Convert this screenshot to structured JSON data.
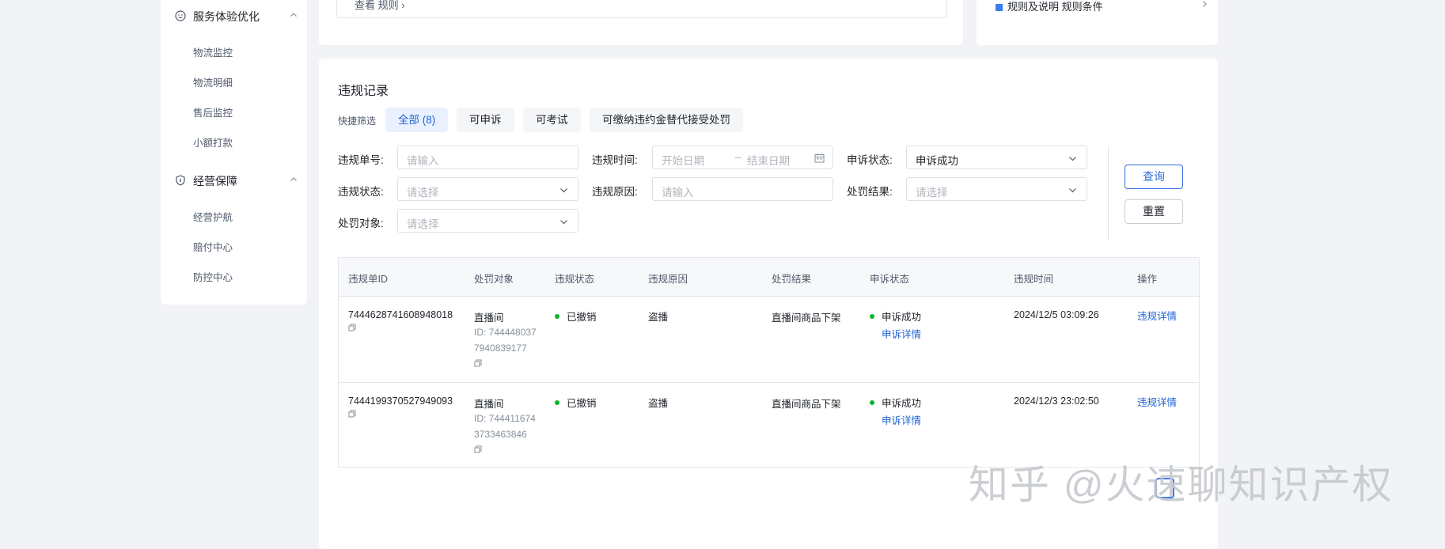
{
  "sidebar": {
    "groups": [
      {
        "label": "服务体验优化",
        "items": [
          "物流监控",
          "物流明细",
          "售后监控",
          "小额打款"
        ]
      },
      {
        "label": "经营保障",
        "items": [
          "经营护航",
          "赔付中心",
          "防控中心"
        ]
      }
    ]
  },
  "top": {
    "left_text": "查看 规则 ›",
    "right_link": "规则及说明 规则条件"
  },
  "main": {
    "title": "违规记录",
    "quick_filter_label": "快捷筛选",
    "quick_filters": [
      "全部 (8)",
      "可申诉",
      "可考试",
      "可缴纳违约金替代接受处罚"
    ],
    "form": {
      "violation_no": {
        "label": "违规单号:",
        "placeholder": "请输入"
      },
      "violation_time": {
        "label": "违规时间:",
        "start": "开始日期",
        "sep": "–",
        "end": "结束日期"
      },
      "appeal_status": {
        "label": "申诉状态:",
        "value": "申诉成功"
      },
      "violation_status": {
        "label": "违规状态:",
        "placeholder": "请选择"
      },
      "violation_reason": {
        "label": "违规原因:",
        "placeholder": "请输入"
      },
      "penalty_result": {
        "label": "处罚结果:",
        "placeholder": "请选择"
      },
      "penalty_target": {
        "label": "处罚对象:",
        "placeholder": "请选择"
      }
    },
    "buttons": {
      "query": "查询",
      "reset": "重置"
    },
    "table": {
      "headers": [
        "违规单ID",
        "处罚对象",
        "违规状态",
        "违规原因",
        "处罚结果",
        "申诉状态",
        "违规时间",
        "操作"
      ],
      "rows": [
        {
          "id": "7444628741608948018",
          "target": "直播间",
          "target_id_line1": "ID: 744448037",
          "target_id_line2": "7940839177",
          "status": "已撤销",
          "reason": "盗播",
          "result": "直播间商品下架",
          "appeal": "申诉成功",
          "appeal_link": "申诉详情",
          "time": "2024/12/5 03:09:26",
          "action": "违规详情"
        },
        {
          "id": "7444199370527949093",
          "target": "直播间",
          "target_id_line1": "ID: 744411674",
          "target_id_line2": "3733463846",
          "status": "已撤销",
          "reason": "盗播",
          "result": "直播间商品下架",
          "appeal": "申诉成功",
          "appeal_link": "申诉详情",
          "time": "2024/12/3 23:02:50",
          "action": "违规详情"
        }
      ]
    }
  },
  "watermark": "知乎 @火速聊知识产权",
  "colors": {
    "accent": "#1e62d6",
    "success": "#00b42a",
    "bg": "#f2f3f6"
  }
}
